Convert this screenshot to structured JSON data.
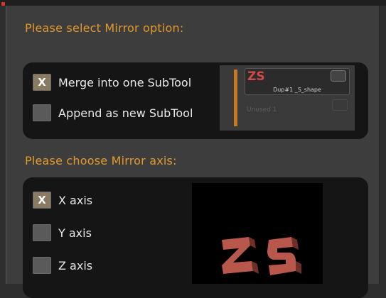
{
  "dialog": {
    "mirror_option_heading": "Please select Mirror option:",
    "mirror_axis_heading": "Please choose Mirror axis:",
    "check_mark": "X"
  },
  "mirror_options": [
    {
      "label": "Merge into one SubTool",
      "checked": true
    },
    {
      "label": "Append as new SubTool",
      "checked": false
    }
  ],
  "subtool_preview": {
    "thumbnail_text": "ZS",
    "name": "Dup#1 _S_shape",
    "unused_label": "Unused 1"
  },
  "mirror_axes": [
    {
      "label": "X axis",
      "checked": true
    },
    {
      "label": "Y axis",
      "checked": false
    },
    {
      "label": "Z axis",
      "checked": false
    }
  ],
  "colors": {
    "accent": "#e39a2a",
    "model": "#b8574c"
  }
}
